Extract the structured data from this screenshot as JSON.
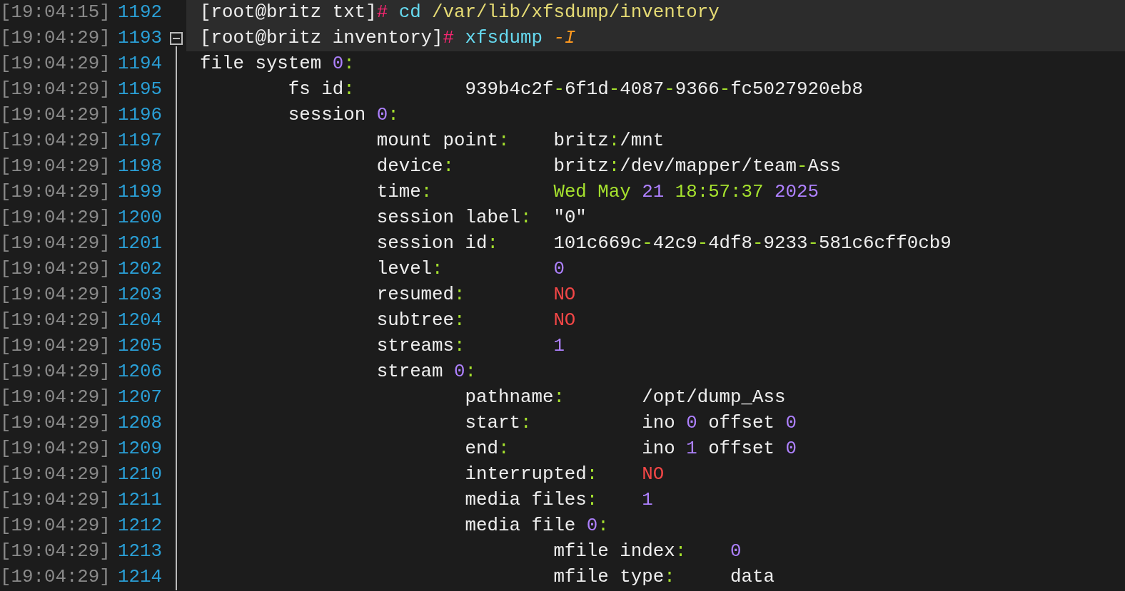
{
  "lines": [
    {
      "time": "[19:04:15]",
      "number": "1192",
      "highlighted": true,
      "kind": "plain",
      "tokens": [
        {
          "text": "[root@britz txt]",
          "color": "#eeeeee"
        },
        {
          "text": "#",
          "color": "#f92672"
        },
        {
          "text": " cd",
          "color": "#66d9ef"
        },
        {
          "text": " /var/lib/xfsdump/inventory",
          "color": "#e6db74"
        }
      ]
    },
    {
      "time": "[19:04:29]",
      "number": "1193",
      "highlighted": true,
      "kind": "fold",
      "tokens": [
        {
          "text": "[root@britz inventory]",
          "color": "#eeeeee"
        },
        {
          "text": "#",
          "color": "#f92672"
        },
        {
          "text": " xfsdump ",
          "color": "#66d9ef"
        },
        {
          "text": "-I",
          "color": "#fd971f",
          "italic": true
        }
      ]
    },
    {
      "time": "[19:04:29]",
      "number": "1194",
      "highlighted": false,
      "kind": "body",
      "tokens": [
        {
          "text": "file system ",
          "color": "#eeeeee"
        },
        {
          "text": "0",
          "color": "#ae81ff"
        },
        {
          "text": ":",
          "color": "#a6e22e"
        }
      ]
    },
    {
      "time": "[19:04:29]",
      "number": "1195",
      "highlighted": false,
      "kind": "body",
      "tokens": [
        {
          "text": "        fs id",
          "color": "#eeeeee"
        },
        {
          "text": ":",
          "color": "#a6e22e"
        },
        {
          "text": "          939b4c2f",
          "color": "#eeeeee"
        },
        {
          "text": "-",
          "color": "#a6e22e"
        },
        {
          "text": "6f1d",
          "color": "#eeeeee"
        },
        {
          "text": "-",
          "color": "#a6e22e"
        },
        {
          "text": "4087",
          "color": "#eeeeee"
        },
        {
          "text": "-",
          "color": "#a6e22e"
        },
        {
          "text": "9366",
          "color": "#eeeeee"
        },
        {
          "text": "-",
          "color": "#a6e22e"
        },
        {
          "text": "fc5027920eb8",
          "color": "#eeeeee"
        }
      ]
    },
    {
      "time": "[19:04:29]",
      "number": "1196",
      "highlighted": false,
      "kind": "body",
      "tokens": [
        {
          "text": "        session ",
          "color": "#eeeeee"
        },
        {
          "text": "0",
          "color": "#ae81ff"
        },
        {
          "text": ":",
          "color": "#a6e22e"
        }
      ]
    },
    {
      "time": "[19:04:29]",
      "number": "1197",
      "highlighted": false,
      "kind": "body",
      "tokens": [
        {
          "text": "                mount point",
          "color": "#eeeeee"
        },
        {
          "text": ":",
          "color": "#a6e22e"
        },
        {
          "text": "    britz",
          "color": "#eeeeee"
        },
        {
          "text": ":",
          "color": "#a6e22e"
        },
        {
          "text": "/mnt",
          "color": "#eeeeee"
        }
      ]
    },
    {
      "time": "[19:04:29]",
      "number": "1198",
      "highlighted": false,
      "kind": "body",
      "tokens": [
        {
          "text": "                device",
          "color": "#eeeeee"
        },
        {
          "text": ":",
          "color": "#a6e22e"
        },
        {
          "text": "         britz",
          "color": "#eeeeee"
        },
        {
          "text": ":",
          "color": "#a6e22e"
        },
        {
          "text": "/dev/mapper/team",
          "color": "#eeeeee"
        },
        {
          "text": "-",
          "color": "#a6e22e"
        },
        {
          "text": "Ass",
          "color": "#eeeeee"
        }
      ]
    },
    {
      "time": "[19:04:29]",
      "number": "1199",
      "highlighted": false,
      "kind": "body",
      "tokens": [
        {
          "text": "                time",
          "color": "#eeeeee"
        },
        {
          "text": ":",
          "color": "#a6e22e"
        },
        {
          "text": "           Wed May ",
          "color": "#a6e22e"
        },
        {
          "text": "21",
          "color": "#ae81ff"
        },
        {
          "text": " 18:57:37 ",
          "color": "#a6e22e"
        },
        {
          "text": "2025",
          "color": "#ae81ff"
        }
      ]
    },
    {
      "time": "[19:04:29]",
      "number": "1200",
      "highlighted": false,
      "kind": "body",
      "tokens": [
        {
          "text": "                session label",
          "color": "#eeeeee"
        },
        {
          "text": ":",
          "color": "#a6e22e"
        },
        {
          "text": "  \"0\"",
          "color": "#eeeeee"
        }
      ]
    },
    {
      "time": "[19:04:29]",
      "number": "1201",
      "highlighted": false,
      "kind": "body",
      "tokens": [
        {
          "text": "                session id",
          "color": "#eeeeee"
        },
        {
          "text": ":",
          "color": "#a6e22e"
        },
        {
          "text": "     101c669c",
          "color": "#eeeeee"
        },
        {
          "text": "-",
          "color": "#a6e22e"
        },
        {
          "text": "42c9",
          "color": "#eeeeee"
        },
        {
          "text": "-",
          "color": "#a6e22e"
        },
        {
          "text": "4df8",
          "color": "#eeeeee"
        },
        {
          "text": "-",
          "color": "#a6e22e"
        },
        {
          "text": "9233",
          "color": "#eeeeee"
        },
        {
          "text": "-",
          "color": "#a6e22e"
        },
        {
          "text": "581c6cff0cb9",
          "color": "#eeeeee"
        }
      ]
    },
    {
      "time": "[19:04:29]",
      "number": "1202",
      "highlighted": false,
      "kind": "body",
      "tokens": [
        {
          "text": "                level",
          "color": "#eeeeee"
        },
        {
          "text": ":",
          "color": "#a6e22e"
        },
        {
          "text": "          0",
          "color": "#ae81ff"
        }
      ]
    },
    {
      "time": "[19:04:29]",
      "number": "1203",
      "highlighted": false,
      "kind": "body",
      "tokens": [
        {
          "text": "                resumed",
          "color": "#eeeeee"
        },
        {
          "text": ":",
          "color": "#a6e22e"
        },
        {
          "text": "        NO",
          "color": "#f44747"
        }
      ]
    },
    {
      "time": "[19:04:29]",
      "number": "1204",
      "highlighted": false,
      "kind": "body",
      "tokens": [
        {
          "text": "                subtree",
          "color": "#eeeeee"
        },
        {
          "text": ":",
          "color": "#a6e22e"
        },
        {
          "text": "        NO",
          "color": "#f44747"
        }
      ]
    },
    {
      "time": "[19:04:29]",
      "number": "1205",
      "highlighted": false,
      "kind": "body",
      "tokens": [
        {
          "text": "                streams",
          "color": "#eeeeee"
        },
        {
          "text": ":",
          "color": "#a6e22e"
        },
        {
          "text": "        1",
          "color": "#ae81ff"
        }
      ]
    },
    {
      "time": "[19:04:29]",
      "number": "1206",
      "highlighted": false,
      "kind": "body",
      "tokens": [
        {
          "text": "                stream ",
          "color": "#eeeeee"
        },
        {
          "text": "0",
          "color": "#ae81ff"
        },
        {
          "text": ":",
          "color": "#a6e22e"
        }
      ]
    },
    {
      "time": "[19:04:29]",
      "number": "1207",
      "highlighted": false,
      "kind": "body",
      "tokens": [
        {
          "text": "                        pathname",
          "color": "#eeeeee"
        },
        {
          "text": ":",
          "color": "#a6e22e"
        },
        {
          "text": "       /opt/dump_Ass",
          "color": "#eeeeee"
        }
      ]
    },
    {
      "time": "[19:04:29]",
      "number": "1208",
      "highlighted": false,
      "kind": "body",
      "tokens": [
        {
          "text": "                        start",
          "color": "#eeeeee"
        },
        {
          "text": ":",
          "color": "#a6e22e"
        },
        {
          "text": "          ino ",
          "color": "#eeeeee"
        },
        {
          "text": "0",
          "color": "#ae81ff"
        },
        {
          "text": " offset ",
          "color": "#eeeeee"
        },
        {
          "text": "0",
          "color": "#ae81ff"
        }
      ]
    },
    {
      "time": "[19:04:29]",
      "number": "1209",
      "highlighted": false,
      "kind": "body",
      "tokens": [
        {
          "text": "                        end",
          "color": "#eeeeee"
        },
        {
          "text": ":",
          "color": "#a6e22e"
        },
        {
          "text": "            ino ",
          "color": "#eeeeee"
        },
        {
          "text": "1",
          "color": "#ae81ff"
        },
        {
          "text": " offset ",
          "color": "#eeeeee"
        },
        {
          "text": "0",
          "color": "#ae81ff"
        }
      ]
    },
    {
      "time": "[19:04:29]",
      "number": "1210",
      "highlighted": false,
      "kind": "body",
      "tokens": [
        {
          "text": "                        interrupted",
          "color": "#eeeeee"
        },
        {
          "text": ":",
          "color": "#a6e22e"
        },
        {
          "text": "    NO",
          "color": "#f44747"
        }
      ]
    },
    {
      "time": "[19:04:29]",
      "number": "1211",
      "highlighted": false,
      "kind": "body",
      "tokens": [
        {
          "text": "                        media files",
          "color": "#eeeeee"
        },
        {
          "text": ":",
          "color": "#a6e22e"
        },
        {
          "text": "    1",
          "color": "#ae81ff"
        }
      ]
    },
    {
      "time": "[19:04:29]",
      "number": "1212",
      "highlighted": false,
      "kind": "body",
      "tokens": [
        {
          "text": "                        media file ",
          "color": "#eeeeee"
        },
        {
          "text": "0",
          "color": "#ae81ff"
        },
        {
          "text": ":",
          "color": "#a6e22e"
        }
      ]
    },
    {
      "time": "[19:04:29]",
      "number": "1213",
      "highlighted": false,
      "kind": "body",
      "tokens": [
        {
          "text": "                                mfile index",
          "color": "#eeeeee"
        },
        {
          "text": ":",
          "color": "#a6e22e"
        },
        {
          "text": "    0",
          "color": "#ae81ff"
        }
      ]
    },
    {
      "time": "[19:04:29]",
      "number": "1214",
      "highlighted": false,
      "kind": "body",
      "tokens": [
        {
          "text": "                                mfile type",
          "color": "#eeeeee"
        },
        {
          "text": ":",
          "color": "#a6e22e"
        },
        {
          "text": "     data",
          "color": "#eeeeee"
        }
      ]
    }
  ]
}
